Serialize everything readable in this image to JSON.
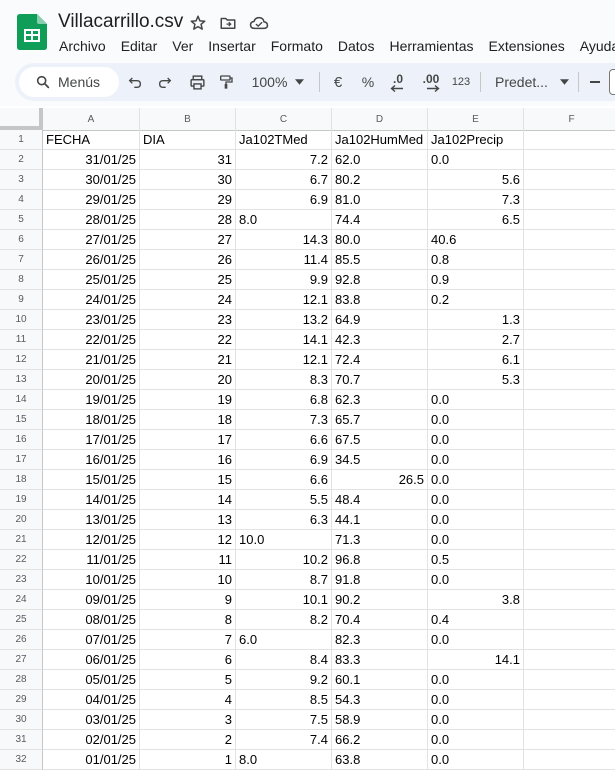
{
  "document": {
    "title": "Villacarrillo.csv"
  },
  "menu": [
    "Archivo",
    "Editar",
    "Ver",
    "Insertar",
    "Formato",
    "Datos",
    "Herramientas",
    "Extensiones",
    "Ayuda"
  ],
  "toolbar": {
    "search_label": "Menús",
    "zoom_value": "100%",
    "currency_symbol": "€",
    "percent_symbol": "%",
    "decrease_decimals": ".0",
    "increase_decimals": ".00",
    "number_format": "123",
    "font_name": "Predet..."
  },
  "grid": {
    "columns": [
      "A",
      "B",
      "C",
      "D",
      "E",
      "F"
    ],
    "rows": [
      {
        "n": "1",
        "c": [
          "FECHA",
          "DIA",
          "Ja102TMed",
          "Ja102HumMed",
          "Ja102Precip",
          ""
        ],
        "a": [
          "l",
          "l",
          "l",
          "l",
          "l",
          "l"
        ]
      },
      {
        "n": "2",
        "c": [
          "31/01/25",
          "31",
          "7.2",
          "62.0",
          "0.0",
          ""
        ],
        "a": [
          "r",
          "r",
          "r",
          "l",
          "l",
          "l"
        ]
      },
      {
        "n": "3",
        "c": [
          "30/01/25",
          "30",
          "6.7",
          "80.2",
          "5.6",
          ""
        ],
        "a": [
          "r",
          "r",
          "r",
          "l",
          "r",
          "l"
        ]
      },
      {
        "n": "4",
        "c": [
          "29/01/25",
          "29",
          "6.9",
          "81.0",
          "7.3",
          ""
        ],
        "a": [
          "r",
          "r",
          "r",
          "l",
          "r",
          "l"
        ]
      },
      {
        "n": "5",
        "c": [
          "28/01/25",
          "28",
          "8.0",
          "74.4",
          "6.5",
          ""
        ],
        "a": [
          "r",
          "r",
          "l",
          "l",
          "r",
          "l"
        ]
      },
      {
        "n": "6",
        "c": [
          "27/01/25",
          "27",
          "14.3",
          "80.0",
          "40.6",
          ""
        ],
        "a": [
          "r",
          "r",
          "r",
          "l",
          "l",
          "l"
        ]
      },
      {
        "n": "7",
        "c": [
          "26/01/25",
          "26",
          "11.4",
          "85.5",
          "0.8",
          ""
        ],
        "a": [
          "r",
          "r",
          "r",
          "l",
          "l",
          "l"
        ]
      },
      {
        "n": "8",
        "c": [
          "25/01/25",
          "25",
          "9.9",
          "92.8",
          "0.9",
          ""
        ],
        "a": [
          "r",
          "r",
          "r",
          "l",
          "l",
          "l"
        ]
      },
      {
        "n": "9",
        "c": [
          "24/01/25",
          "24",
          "12.1",
          "83.8",
          "0.2",
          ""
        ],
        "a": [
          "r",
          "r",
          "r",
          "l",
          "l",
          "l"
        ]
      },
      {
        "n": "10",
        "c": [
          "23/01/25",
          "23",
          "13.2",
          "64.9",
          "1.3",
          ""
        ],
        "a": [
          "r",
          "r",
          "r",
          "l",
          "r",
          "l"
        ]
      },
      {
        "n": "11",
        "c": [
          "22/01/25",
          "22",
          "14.1",
          "42.3",
          "2.7",
          ""
        ],
        "a": [
          "r",
          "r",
          "r",
          "l",
          "r",
          "l"
        ]
      },
      {
        "n": "12",
        "c": [
          "21/01/25",
          "21",
          "12.1",
          "72.4",
          "6.1",
          ""
        ],
        "a": [
          "r",
          "r",
          "r",
          "l",
          "r",
          "l"
        ]
      },
      {
        "n": "13",
        "c": [
          "20/01/25",
          "20",
          "8.3",
          "70.7",
          "5.3",
          ""
        ],
        "a": [
          "r",
          "r",
          "r",
          "l",
          "r",
          "l"
        ]
      },
      {
        "n": "14",
        "c": [
          "19/01/25",
          "19",
          "6.8",
          "62.3",
          "0.0",
          ""
        ],
        "a": [
          "r",
          "r",
          "r",
          "l",
          "l",
          "l"
        ]
      },
      {
        "n": "15",
        "c": [
          "18/01/25",
          "18",
          "7.3",
          "65.7",
          "0.0",
          ""
        ],
        "a": [
          "r",
          "r",
          "r",
          "l",
          "l",
          "l"
        ]
      },
      {
        "n": "16",
        "c": [
          "17/01/25",
          "17",
          "6.6",
          "67.5",
          "0.0",
          ""
        ],
        "a": [
          "r",
          "r",
          "r",
          "l",
          "l",
          "l"
        ]
      },
      {
        "n": "17",
        "c": [
          "16/01/25",
          "16",
          "6.9",
          "34.5",
          "0.0",
          ""
        ],
        "a": [
          "r",
          "r",
          "r",
          "l",
          "l",
          "l"
        ]
      },
      {
        "n": "18",
        "c": [
          "15/01/25",
          "15",
          "6.6",
          "26.5",
          "0.0",
          ""
        ],
        "a": [
          "r",
          "r",
          "r",
          "r",
          "l",
          "l"
        ]
      },
      {
        "n": "19",
        "c": [
          "14/01/25",
          "14",
          "5.5",
          "48.4",
          "0.0",
          ""
        ],
        "a": [
          "r",
          "r",
          "r",
          "l",
          "l",
          "l"
        ]
      },
      {
        "n": "20",
        "c": [
          "13/01/25",
          "13",
          "6.3",
          "44.1",
          "0.0",
          ""
        ],
        "a": [
          "r",
          "r",
          "r",
          "l",
          "l",
          "l"
        ]
      },
      {
        "n": "21",
        "c": [
          "12/01/25",
          "12",
          "10.0",
          "71.3",
          "0.0",
          ""
        ],
        "a": [
          "r",
          "r",
          "l",
          "l",
          "l",
          "l"
        ]
      },
      {
        "n": "22",
        "c": [
          "11/01/25",
          "11",
          "10.2",
          "96.8",
          "0.5",
          ""
        ],
        "a": [
          "r",
          "r",
          "r",
          "l",
          "l",
          "l"
        ]
      },
      {
        "n": "23",
        "c": [
          "10/01/25",
          "10",
          "8.7",
          "91.8",
          "0.0",
          ""
        ],
        "a": [
          "r",
          "r",
          "r",
          "l",
          "l",
          "l"
        ]
      },
      {
        "n": "24",
        "c": [
          "09/01/25",
          "9",
          "10.1",
          "90.2",
          "3.8",
          ""
        ],
        "a": [
          "r",
          "r",
          "r",
          "l",
          "r",
          "l"
        ]
      },
      {
        "n": "25",
        "c": [
          "08/01/25",
          "8",
          "8.2",
          "70.4",
          "0.4",
          ""
        ],
        "a": [
          "r",
          "r",
          "r",
          "l",
          "l",
          "l"
        ]
      },
      {
        "n": "26",
        "c": [
          "07/01/25",
          "7",
          "6.0",
          "82.3",
          "0.0",
          ""
        ],
        "a": [
          "r",
          "r",
          "l",
          "l",
          "l",
          "l"
        ]
      },
      {
        "n": "27",
        "c": [
          "06/01/25",
          "6",
          "8.4",
          "83.3",
          "14.1",
          ""
        ],
        "a": [
          "r",
          "r",
          "r",
          "l",
          "r",
          "l"
        ]
      },
      {
        "n": "28",
        "c": [
          "05/01/25",
          "5",
          "9.2",
          "60.1",
          "0.0",
          ""
        ],
        "a": [
          "r",
          "r",
          "r",
          "l",
          "l",
          "l"
        ]
      },
      {
        "n": "29",
        "c": [
          "04/01/25",
          "4",
          "8.5",
          "54.3",
          "0.0",
          ""
        ],
        "a": [
          "r",
          "r",
          "r",
          "l",
          "l",
          "l"
        ]
      },
      {
        "n": "30",
        "c": [
          "03/01/25",
          "3",
          "7.5",
          "58.9",
          "0.0",
          ""
        ],
        "a": [
          "r",
          "r",
          "r",
          "l",
          "l",
          "l"
        ]
      },
      {
        "n": "31",
        "c": [
          "02/01/25",
          "2",
          "7.4",
          "66.2",
          "0.0",
          ""
        ],
        "a": [
          "r",
          "r",
          "r",
          "l",
          "l",
          "l"
        ]
      },
      {
        "n": "32",
        "c": [
          "01/01/25",
          "1",
          "8.0",
          "63.8",
          "0.0",
          ""
        ],
        "a": [
          "r",
          "r",
          "l",
          "l",
          "l",
          "l"
        ]
      }
    ]
  },
  "colors": {
    "accent": "#0b57d0",
    "sheets_green": "#0f9d58",
    "toolbar_bg": "#edf2fa",
    "header_bg": "#f8f9fa",
    "grid_line": "#e1e3e1"
  }
}
